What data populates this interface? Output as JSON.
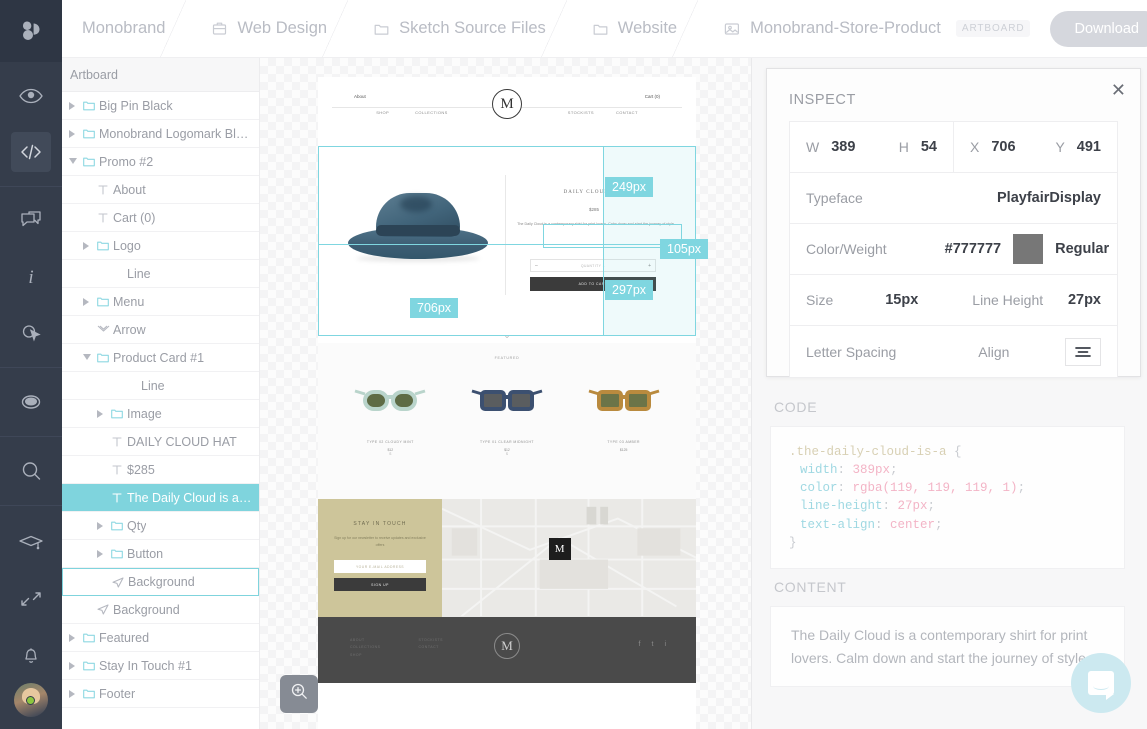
{
  "app": {
    "logo_icon": "avocode-logo-icon"
  },
  "rail": {
    "items": [
      {
        "name": "preview",
        "icon": "eye-icon",
        "active": false
      },
      {
        "name": "code",
        "icon": "code-brackets-icon",
        "active": true
      },
      {
        "name": "comments",
        "icon": "speech-bubble-icon",
        "active": false
      },
      {
        "name": "info",
        "icon": "info-italic-icon",
        "active": false
      },
      {
        "name": "hotspots",
        "icon": "cursor-click-icon",
        "active": false
      },
      {
        "name": "assets",
        "icon": "filled-circle-icon",
        "active": false
      },
      {
        "name": "search",
        "icon": "magnifier-icon",
        "active": false
      },
      {
        "name": "learn",
        "icon": "graduation-cap-icon",
        "active": false
      },
      {
        "name": "fullscreen",
        "icon": "expand-arrows-icon",
        "active": false
      },
      {
        "name": "notifications",
        "icon": "bell-icon",
        "active": false
      }
    ]
  },
  "header": {
    "breadcrumbs": [
      {
        "label": "Monobrand",
        "icon": ""
      },
      {
        "label": "Web Design",
        "icon": "briefcase-icon"
      },
      {
        "label": "Sketch Source Files",
        "icon": "folder-icon"
      },
      {
        "label": "Website",
        "icon": "folder-icon"
      },
      {
        "label": "Monobrand-Store-Product",
        "icon": "image-icon",
        "badge": "ARTBOARD"
      }
    ],
    "download_label": "Download"
  },
  "layers": {
    "header": "Artboard",
    "rows": [
      {
        "label": "Big Pin Black",
        "icon": "folder-icon",
        "twisty": "right",
        "indent": 0
      },
      {
        "label": "Monobrand Logomark Black",
        "icon": "folder-icon",
        "twisty": "right",
        "indent": 0
      },
      {
        "label": "Promo #2",
        "icon": "folder-icon",
        "twisty": "down",
        "indent": 0
      },
      {
        "label": "About",
        "icon": "text-icon",
        "twisty": "",
        "indent": 1
      },
      {
        "label": "Cart (0)",
        "icon": "text-icon",
        "twisty": "",
        "indent": 1
      },
      {
        "label": "Logo",
        "icon": "folder-icon",
        "twisty": "right",
        "indent": 1
      },
      {
        "label": "Line",
        "icon": "",
        "twisty": "",
        "indent": 2
      },
      {
        "label": "Menu",
        "icon": "folder-icon",
        "twisty": "right",
        "indent": 1
      },
      {
        "label": "Arrow",
        "icon": "chevron-shape-icon",
        "twisty": "",
        "indent": 1
      },
      {
        "label": "Product Card #1",
        "icon": "folder-icon",
        "twisty": "down",
        "indent": 1
      },
      {
        "label": "Line",
        "icon": "",
        "twisty": "",
        "indent": 3
      },
      {
        "label": "Image",
        "icon": "folder-icon",
        "twisty": "right",
        "indent": 2
      },
      {
        "label": "DAILY CLOUD HAT",
        "icon": "text-icon",
        "twisty": "",
        "indent": 2
      },
      {
        "label": "$285",
        "icon": "text-icon",
        "twisty": "",
        "indent": 2
      },
      {
        "label": "The Daily Cloud is a conte...",
        "icon": "text-icon",
        "twisty": "",
        "indent": 2,
        "selected": true
      },
      {
        "label": "Qty",
        "icon": "folder-icon",
        "twisty": "right",
        "indent": 2
      },
      {
        "label": "Button",
        "icon": "folder-icon",
        "twisty": "right",
        "indent": 2
      },
      {
        "label": "Background",
        "icon": "shape-icon",
        "twisty": "",
        "indent": 2,
        "outlined": true
      },
      {
        "label": "Background",
        "icon": "shape-icon",
        "twisty": "",
        "indent": 1
      },
      {
        "label": "Featured",
        "icon": "folder-icon",
        "twisty": "right",
        "indent": 0
      },
      {
        "label": "Stay In Touch #1",
        "icon": "folder-icon",
        "twisty": "right",
        "indent": 0
      },
      {
        "label": "Footer",
        "icon": "folder-icon",
        "twisty": "right",
        "indent": 0
      }
    ]
  },
  "canvas": {
    "zoom_icon": "zoom-in-icon",
    "measurements": [
      {
        "value": "706px"
      },
      {
        "value": "249px"
      },
      {
        "value": "105px"
      },
      {
        "value": "297px"
      }
    ],
    "artboard": {
      "nav": {
        "about": "About",
        "cart": "Cart (0)",
        "logo": "M",
        "menu_left": [
          "SHOP",
          "COLLECTIONS"
        ],
        "menu_right": [
          "STOCKISTS",
          "CONTACT"
        ]
      },
      "product": {
        "title": "DAILY CLOUD HAT",
        "price": "$285",
        "description": "The Daily Cloud is a contemporary shirt for print lovers. Calm down and start the journey of style.",
        "qty_label": "QUANTITY 1",
        "minus": "–",
        "plus": "+",
        "add_button": "ADD TO CART"
      },
      "featured": {
        "heading": "FEATURED",
        "items": [
          {
            "name": "TYPE 02 CLOUDY MINT",
            "price": "$12",
            "size": "S",
            "frame": "#b9d4cb",
            "lens": "#5e6b45"
          },
          {
            "name": "TYPE 01 CLEAR MIDNIGHT",
            "price": "$12",
            "size": "S",
            "frame": "#3c5070",
            "lens": "#5a5d5f"
          },
          {
            "name": "TYPE 03 AMBER",
            "price": "$125",
            "size": "",
            "frame": "#b98a3e",
            "lens": "#6b7448"
          }
        ]
      },
      "stay_in_touch": {
        "heading": "STAY IN TOUCH",
        "text": "Sign up for our newsletter to receive updates and exclusive offers",
        "field_placeholder": "YOUR E-MAIL ADDRESS",
        "button": "SIGN UP",
        "map_logo": "M"
      },
      "footer": {
        "col1": [
          "ABOUT",
          "COLLECTIONS",
          "SHOP"
        ],
        "col2": [
          "STOCKISTS",
          "CONTACT"
        ],
        "logo": "M",
        "social": [
          "f",
          "t",
          "i"
        ]
      }
    }
  },
  "inspect": {
    "title": "INSPECT",
    "close_icon": "close-icon",
    "fields": {
      "w_key": "W",
      "w_val": "389",
      "h_key": "H",
      "h_val": "54",
      "x_key": "X",
      "x_val": "706",
      "y_key": "Y",
      "y_val": "491",
      "typeface_key": "Typeface",
      "typeface_val": "PlayfairDisplay",
      "color_key": "Color/Weight",
      "color_val": "#777777",
      "weight_val": "Regular",
      "swatch_hex": "#777777",
      "size_key": "Size",
      "size_val": "15px",
      "line_height_key": "Line Height",
      "line_height_val": "27px",
      "letter_spacing_key": "Letter Spacing",
      "letter_spacing_val": "",
      "align_key": "Align",
      "align_icon": "align-center-icon"
    }
  },
  "code": {
    "title": "CODE",
    "selector": ".the-daily-cloud-is-a",
    "open_brace": "{",
    "close_brace": "}",
    "lines": [
      {
        "prop": "width",
        "val": "389px"
      },
      {
        "prop": "color",
        "val": "rgba(119, 119, 119, 1)"
      },
      {
        "prop": "line-height",
        "val": "27px"
      },
      {
        "prop": "text-align",
        "val": "center"
      }
    ]
  },
  "content": {
    "title": "CONTENT",
    "text": "The Daily Cloud is a contemporary shirt for print lovers. Calm down and start the journey of style."
  },
  "chat": {
    "icon": "chat-bubble-icon"
  },
  "colors": {
    "rail_bg": "#353d4b",
    "accent_cyan": "#7fd4dd",
    "panel_bg": "#f7f7f8",
    "swatch": "#777777"
  }
}
